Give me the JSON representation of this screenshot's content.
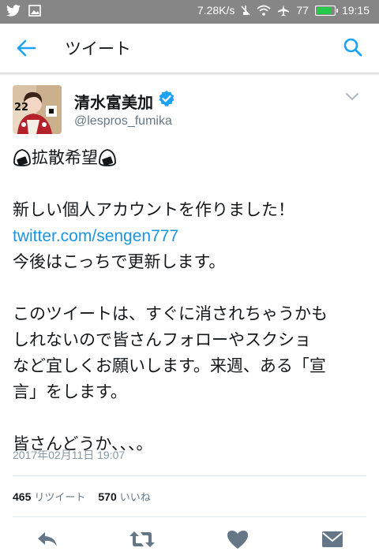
{
  "status_bar": {
    "network_speed": "7.28K/s",
    "battery_percent": "77",
    "battery_level": 0.77,
    "time": "19:15"
  },
  "app_bar": {
    "title": "ツイート"
  },
  "tweet": {
    "display_name": "清水富美加",
    "handle": "@lespros_fumika",
    "avatar_badge": "22",
    "tag_line": "拡散希望",
    "line1": "新しい個人アカウントを作りました！",
    "link": "twitter.com/sengen777",
    "line2": "今後はこっちで更新します。",
    "para2_l1": "このツイートは、すぐに消されちゃうかも",
    "para2_l2": "しれないので皆さんフォローやスクショ",
    "para2_l3": "など宜しくお願いします。来週、ある「宣",
    "para2_l4": "言」をします。",
    "para3": "皆さんどうか、、、。",
    "timestamp": "2017年02月11日 19:07"
  },
  "stats": {
    "retweets_count": "465",
    "retweets_label": "リツイート",
    "likes_count": "570",
    "likes_label": "いいね"
  },
  "colors": {
    "status_bar": "#868686",
    "accent": "#1b95e0",
    "icon_gray": "#657786"
  }
}
